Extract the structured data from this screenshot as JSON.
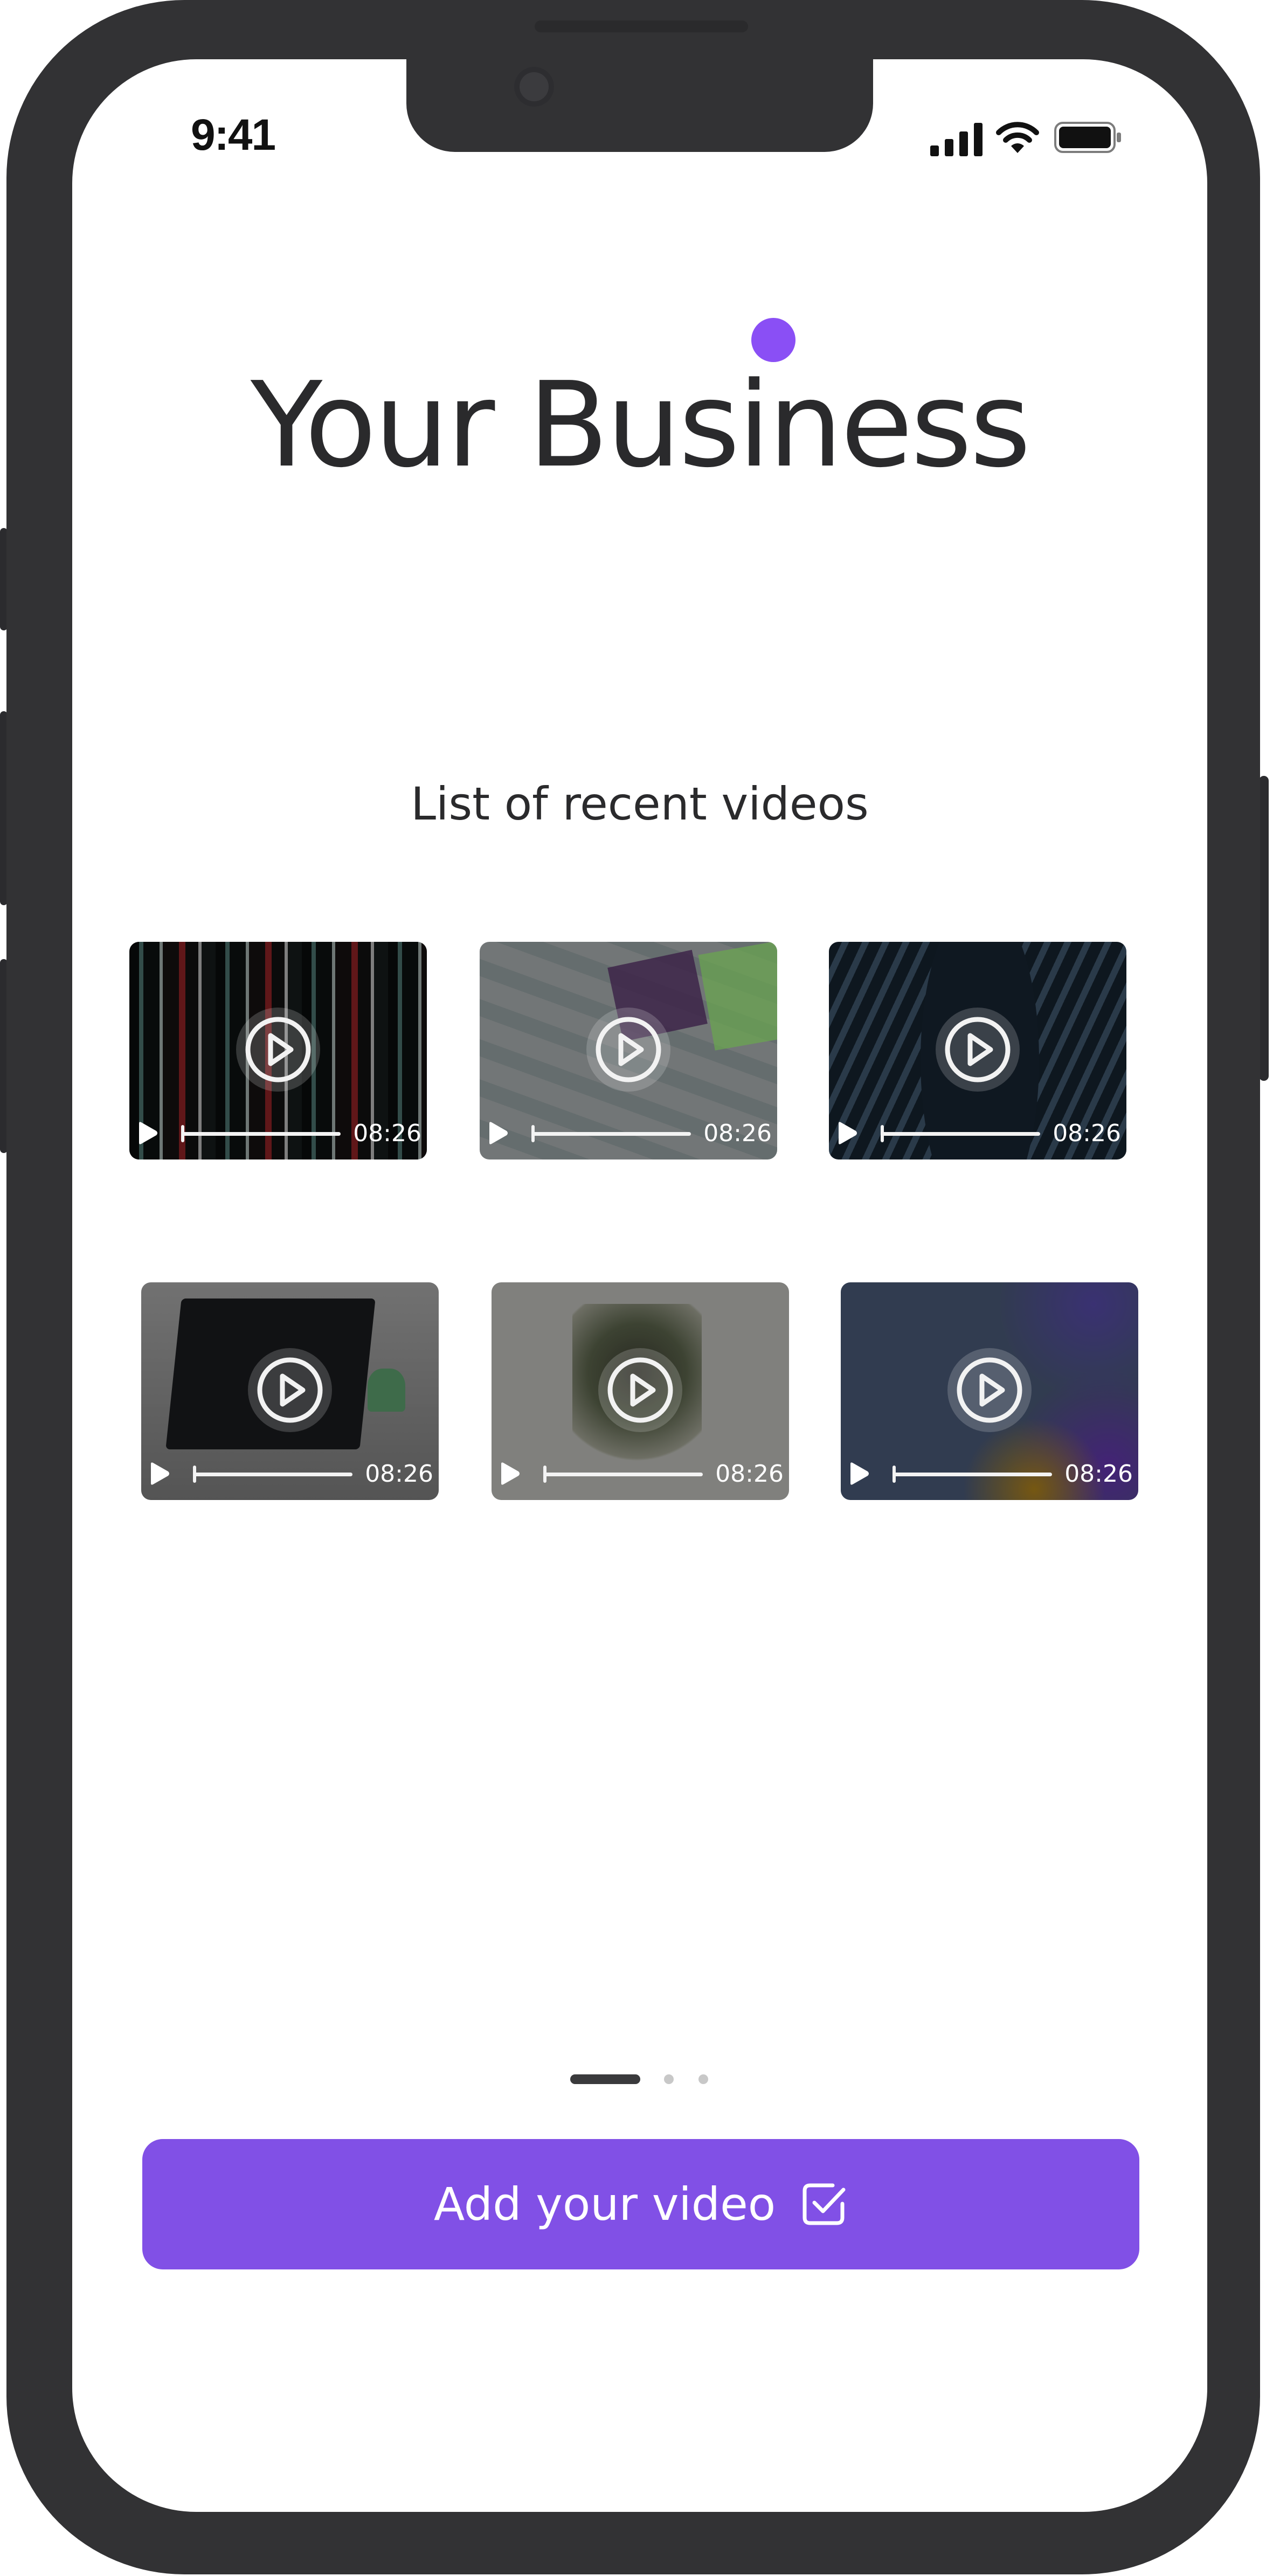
{
  "status_bar": {
    "time": "9:41",
    "icons": [
      "cellular-signal-icon",
      "wifi-icon",
      "battery-icon"
    ]
  },
  "header": {
    "title": "Your Business",
    "accent_color": "#8a4ff5"
  },
  "main": {
    "section_title": "List of recent videos",
    "videos": [
      {
        "duration": "08:26"
      },
      {
        "duration": "08:26"
      },
      {
        "duration": "08:26"
      },
      {
        "duration": "08:26"
      },
      {
        "duration": "08:26"
      },
      {
        "duration": "08:26"
      }
    ]
  },
  "pager": {
    "pages": 3,
    "active_index": 0
  },
  "cta": {
    "label": "Add your video",
    "icon": "checkbox-icon",
    "color": "#8150e6"
  }
}
